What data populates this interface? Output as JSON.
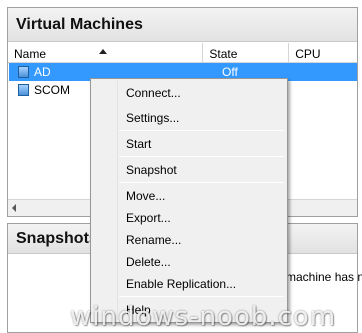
{
  "vm_panel": {
    "title": "Virtual Machines",
    "columns": [
      "Name",
      "State",
      "CPU Usage"
    ],
    "rows": [
      {
        "name": "AD",
        "state": "Off"
      },
      {
        "name": "SCOM",
        "state": ""
      }
    ]
  },
  "snapshots_panel": {
    "title": "Snapshots",
    "partial_text": "machine has no"
  },
  "context_menu": {
    "items": [
      "Connect...",
      "Settings...",
      "Start",
      "Snapshot",
      "Move...",
      "Export...",
      "Rename...",
      "Delete...",
      "Enable Replication...",
      "Help"
    ]
  },
  "watermark": "windows-noob.com",
  "colors": {
    "selection": "#3399ff",
    "menu_bg": "#f0f0f0"
  }
}
